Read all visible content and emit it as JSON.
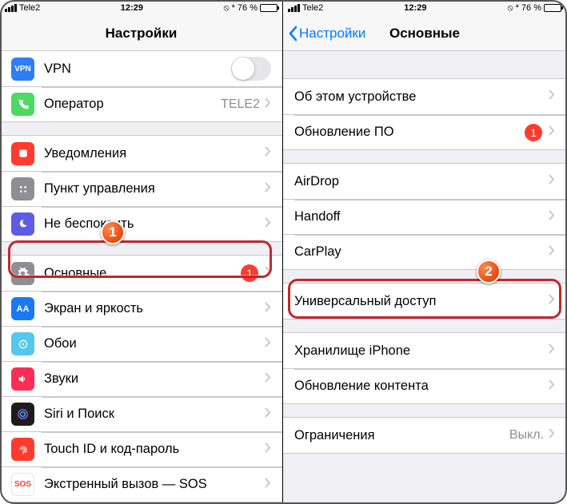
{
  "statusbar": {
    "carrier": "Tele2",
    "time": "12:29",
    "battery_pct": "76 %",
    "bluetooth": "*",
    "orientation_lock": "⦸"
  },
  "left": {
    "title": "Настройки",
    "rows": {
      "vpn": "VPN",
      "carrier": "Оператор",
      "carrier_value": "TELE2",
      "notifications": "Уведомления",
      "control_center": "Пункт управления",
      "dnd": "Не беспокоить",
      "general": "Основные",
      "general_badge": "1",
      "display": "Экран и яркость",
      "wallpaper": "Обои",
      "sounds": "Звуки",
      "siri": "Siri и Поиск",
      "touchid": "Touch ID и код-пароль",
      "sos": "Экстренный вызов — SOS"
    },
    "callout_num": "1"
  },
  "right": {
    "back": "Настройки",
    "title": "Основные",
    "rows": {
      "about": "Об этом устройстве",
      "update": "Обновление ПО",
      "update_badge": "1",
      "airdrop": "AirDrop",
      "handoff": "Handoff",
      "carplay": "CarPlay",
      "accessibility": "Универсальный доступ",
      "storage": "Хранилище iPhone",
      "content": "Обновление контента",
      "restrictions": "Ограничения",
      "restrictions_value": "Выкл."
    },
    "callout_num": "2"
  },
  "icon_text": {
    "vpn": "VPN",
    "display": "AA",
    "sos": "SOS"
  }
}
